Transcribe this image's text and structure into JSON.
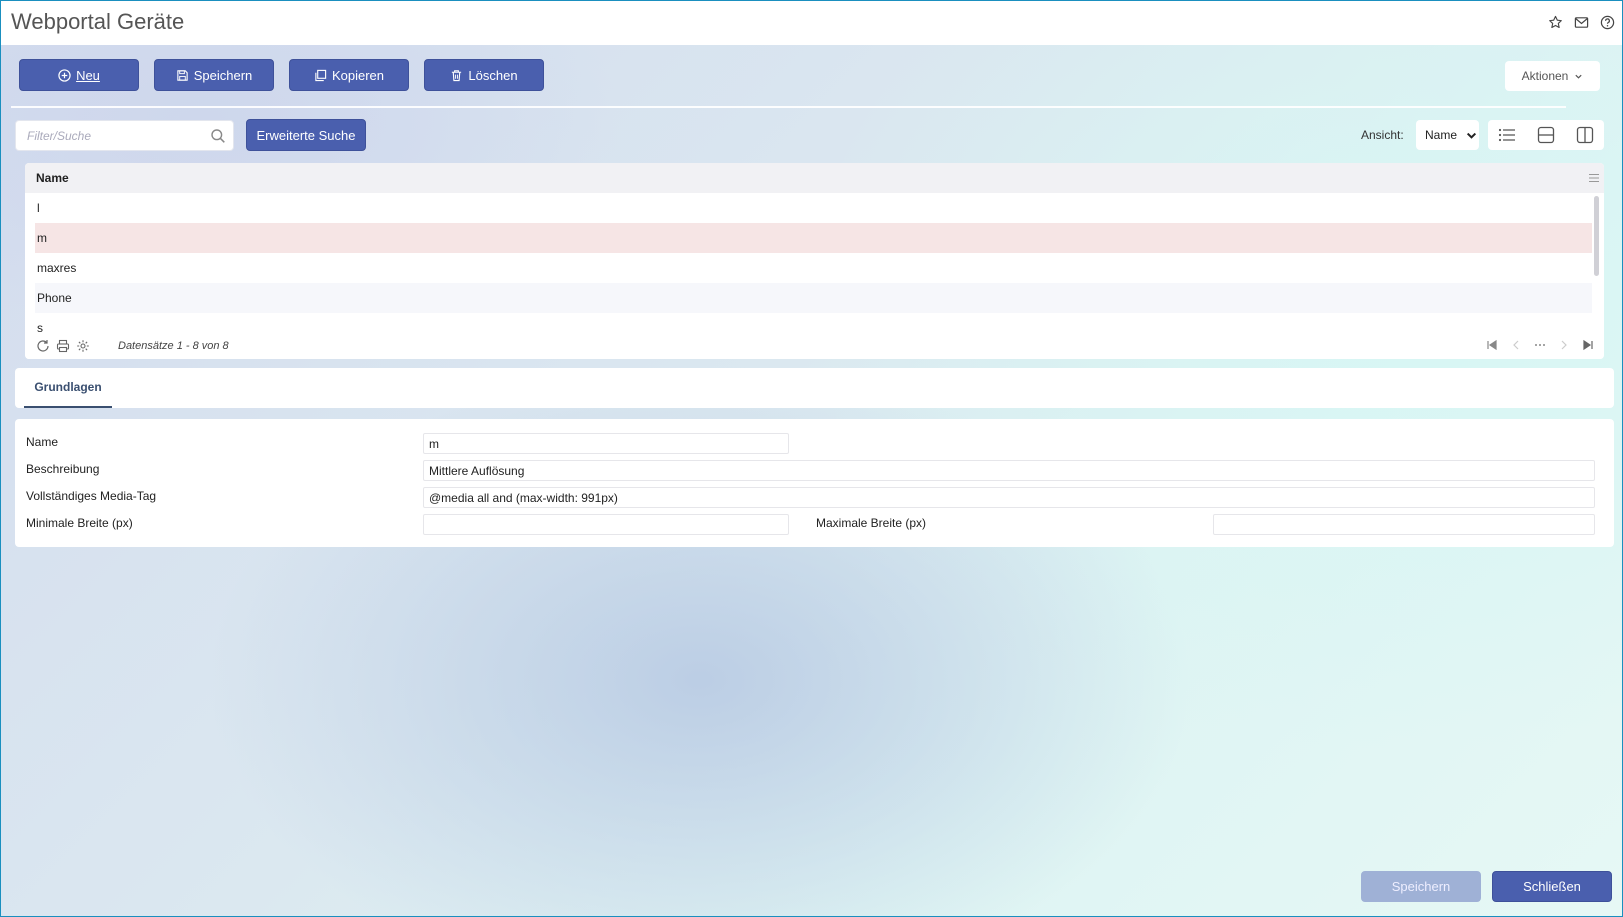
{
  "window": {
    "title": "Webportal Geräte"
  },
  "toolbar": {
    "new_label": "Neu",
    "save_label": "Speichern",
    "copy_label": "Kopieren",
    "delete_label": "Löschen",
    "actions_label": "Aktionen"
  },
  "filter": {
    "placeholder": "Filter/Suche",
    "advanced_search_label": "Erweiterte Suche"
  },
  "view": {
    "label": "Ansicht:",
    "selected": "Name"
  },
  "grid": {
    "column_header": "Name",
    "rows": [
      "l",
      "m",
      "maxres",
      "Phone",
      "s"
    ],
    "selected_row": "m",
    "record_count": "Datensätze 1 - 8 von 8"
  },
  "tabs": [
    {
      "label": "Grundlagen",
      "active": true
    }
  ],
  "form": {
    "name_label": "Name",
    "name_value": "m",
    "description_label": "Beschreibung",
    "description_value": "Mittlere Auflösung",
    "media_tag_label": "Vollständiges Media-Tag",
    "media_tag_value": "@media all and (max-width: 991px)",
    "min_width_label": "Minimale Breite (px)",
    "min_width_value": "",
    "max_width_label": "Maximale Breite (px)",
    "max_width_value": ""
  },
  "footer": {
    "save_label": "Speichern",
    "close_label": "Schließen"
  },
  "colors": {
    "primary": "#4a5fae",
    "selected_row": "#f6e5e5",
    "disabled_button": "#9fb1d6",
    "active_tab": "#3a4f70"
  },
  "icons": [
    "star-icon",
    "mail-icon",
    "help-icon",
    "plus-circle-icon",
    "save-icon",
    "copy-icon",
    "trash-icon",
    "chevron-down-icon",
    "search-icon",
    "list-view-icon",
    "split-horizontal-icon",
    "split-vertical-icon",
    "column-menu-icon",
    "refresh-icon",
    "print-icon",
    "settings-icon",
    "first-page-icon",
    "prev-page-icon",
    "more-pages-icon",
    "next-page-icon",
    "last-page-icon"
  ]
}
